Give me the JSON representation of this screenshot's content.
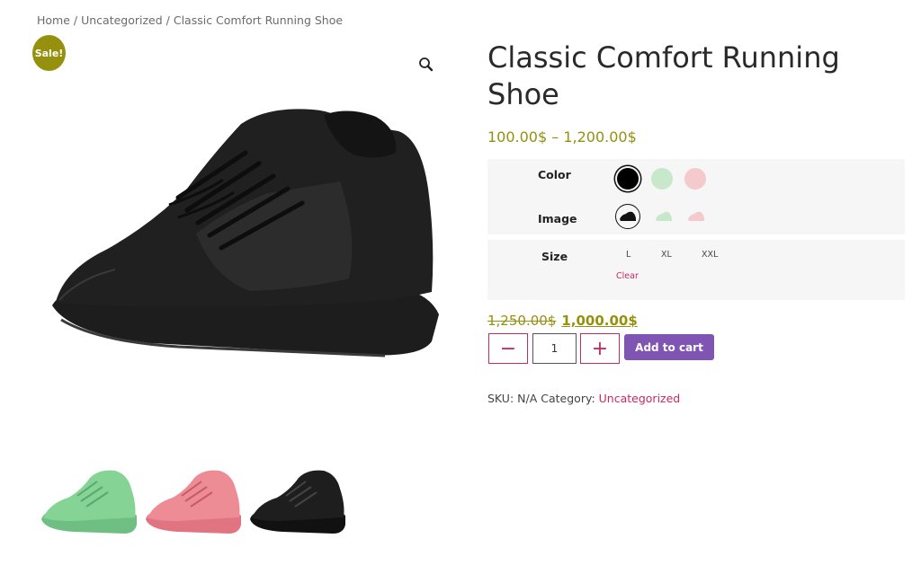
{
  "breadcrumb": {
    "home": "Home",
    "category": "Uncategorized",
    "current": "Classic Comfort Running Shoe",
    "separator": " / "
  },
  "gallery": {
    "sale_badge": "Sale!",
    "zoom_icon": "magnifier-icon",
    "thumbnails": [
      {
        "name": "green",
        "color": "#85d496"
      },
      {
        "name": "pink",
        "color": "#ee8c95"
      },
      {
        "name": "black",
        "color": "#1a1a1a"
      }
    ]
  },
  "product": {
    "title": "Classic Comfort Running Shoe",
    "price_range": "100.00$ – 1,200.00$",
    "variations": {
      "color_label": "Color",
      "colors": [
        {
          "name": "black",
          "hex": "#000000",
          "selected": true
        },
        {
          "name": "green",
          "hex": "#c8e8cc",
          "selected": false
        },
        {
          "name": "pink",
          "hex": "#f4cacc",
          "selected": false
        }
      ],
      "image_label": "Image",
      "size_label": "Size",
      "sizes": [
        "L",
        "XL",
        "XXL"
      ],
      "clear_label": "Clear"
    },
    "old_price": "1,250.00$",
    "new_price": "1,000.00$",
    "quantity": "1",
    "minus_label": "−",
    "plus_label": "+",
    "add_to_cart_label": "Add to cart",
    "sku_label": "SKU:",
    "sku_value": "N/A",
    "category_label": "Category:",
    "category_value": "Uncategorized"
  },
  "colors": {
    "accent_olive": "#96900f",
    "accent_crimson": "#c72a5e",
    "button_purple": "#7f54b3"
  }
}
